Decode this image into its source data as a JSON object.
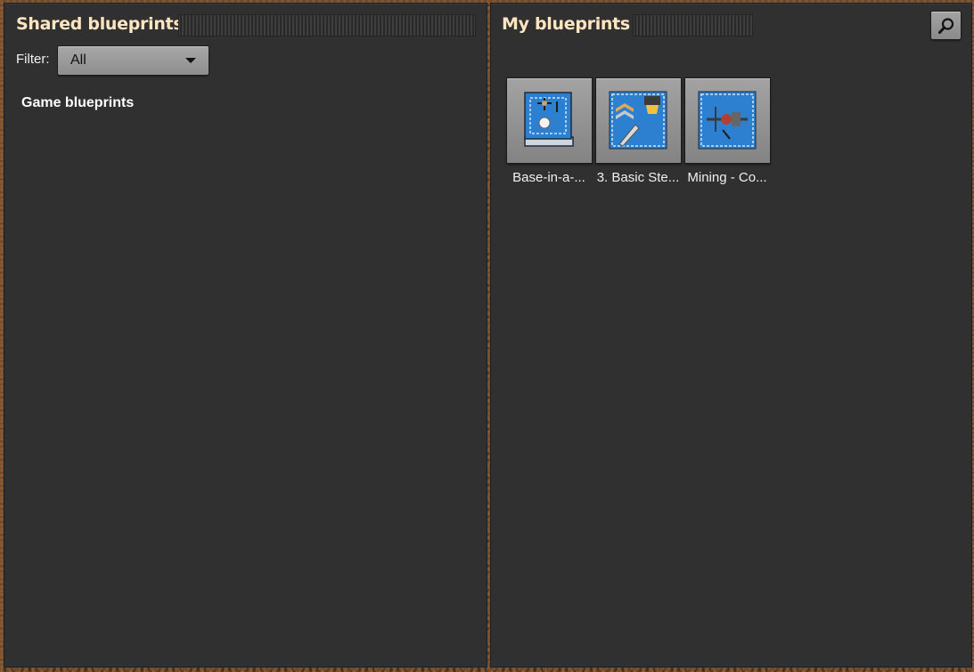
{
  "shared_blueprints": {
    "title": "Shared blueprints",
    "filter": {
      "label": "Filter:",
      "selected": "All"
    },
    "section_label": "Game blueprints"
  },
  "my_blueprints": {
    "title": "My blueprints",
    "search_icon": "search-icon",
    "items": [
      {
        "name": "Base-in-a-...",
        "icon": "blueprint-book-icon"
      },
      {
        "name": "3. Basic Ste...",
        "icon": "blueprint-icon"
      },
      {
        "name": "Mining - Co...",
        "icon": "blueprint-icon"
      }
    ]
  },
  "colors": {
    "panel_bg": "#313031",
    "title": "#ffe6c0",
    "blueprint_blue": "#2d7fd0"
  }
}
